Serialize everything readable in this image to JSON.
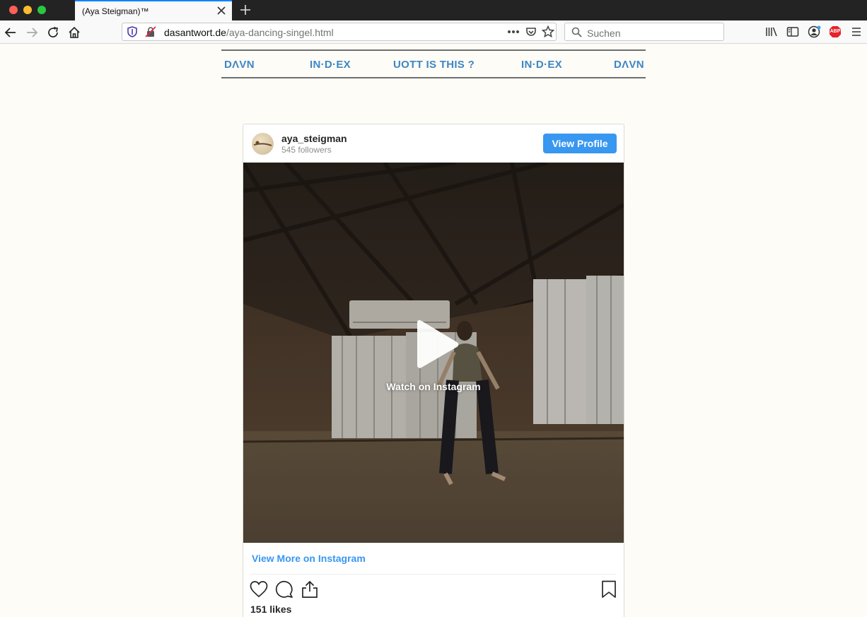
{
  "browser": {
    "tab_title": "(Aya Steigman)™",
    "url_domain": "dasantwort.de",
    "url_path": "/aya-dancing-singel.html",
    "search_placeholder": "Suchen",
    "addon_badge": "ABP"
  },
  "sitenav": {
    "items": [
      "DΛVN",
      "IN·D·EX",
      "UOTT IS THIS ?",
      "IN·D·EX",
      "DΛVN"
    ]
  },
  "embed": {
    "username": "aya_steigman",
    "followers": "545 followers",
    "view_profile_label": "View Profile",
    "watch_label": "Watch on Instagram",
    "view_more_label": "View More on Instagram",
    "likes": "151 likes"
  },
  "colors": {
    "accent": "#3897f0",
    "nav_link": "#3d86c6",
    "page_bg": "#fdfcf6"
  }
}
